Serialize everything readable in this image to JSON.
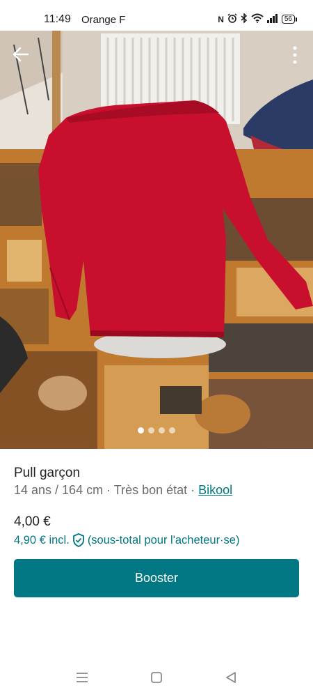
{
  "status_bar": {
    "time": "11:49",
    "carrier": "Orange F",
    "icons": [
      "nfc-icon",
      "alarm-icon",
      "bluetooth-icon",
      "wifi-icon",
      "signal-icon",
      "battery-icon"
    ],
    "battery": "56"
  },
  "photo": {
    "pages": 4,
    "active_page": 1
  },
  "item": {
    "title": "Pull garçon",
    "size": "14 ans / 164 cm",
    "separator1": " · ",
    "condition": "Très bon état",
    "separator2": " · ",
    "brand": "Bikool",
    "price": "4,00 €",
    "price_incl": "4,90 € incl.",
    "price_incl_note": "(sous-total pour l'acheteur·se)"
  },
  "actions": {
    "booster_label": "Booster"
  },
  "colors": {
    "accent": "#007782",
    "text": "#222222",
    "muted": "#6b6b6b"
  }
}
